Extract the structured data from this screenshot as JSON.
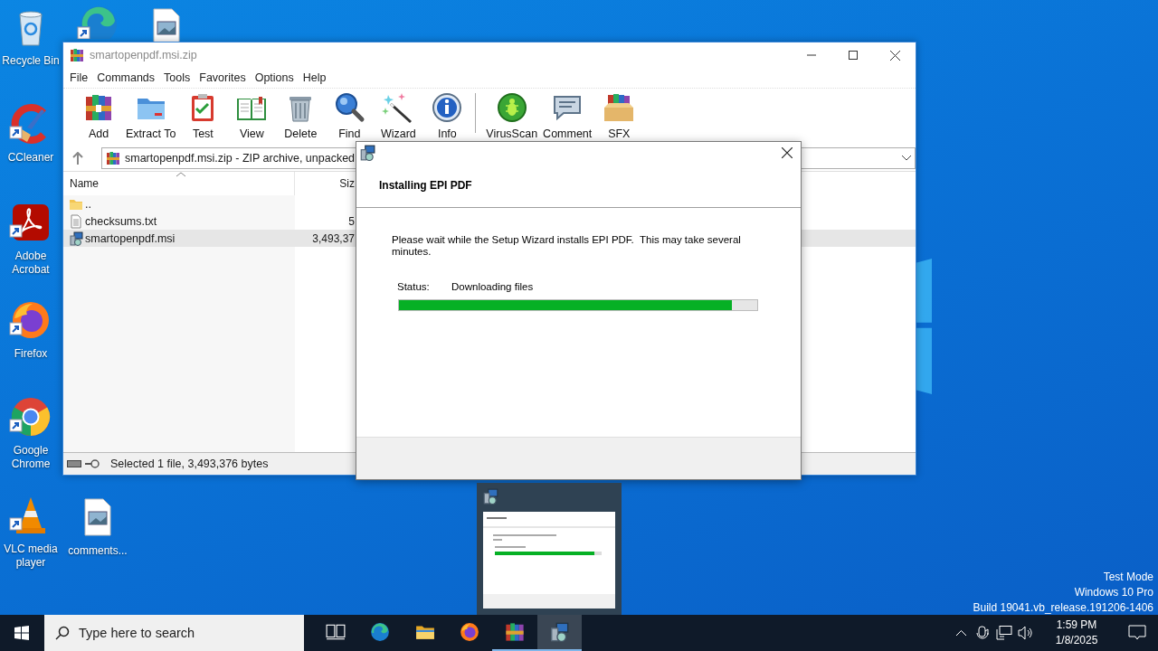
{
  "desktop_icons": [
    {
      "kind": "recycle-bin",
      "label": "Recycle Bin",
      "shortcut": false
    },
    {
      "kind": "edge",
      "shortcut": true
    },
    {
      "kind": "image-file",
      "shortcut": false
    },
    {
      "kind": "ccleaner",
      "label": "CCleaner",
      "shortcut": true
    },
    {
      "kind": "acrobat",
      "label": "Adobe Acrobat",
      "shortcut": true
    },
    {
      "kind": "firefox",
      "label": "Firefox",
      "shortcut": true
    },
    {
      "kind": "chrome",
      "label": "Google Chrome",
      "shortcut": true
    },
    {
      "kind": "vlc",
      "label": "VLC media player",
      "shortcut": true
    },
    {
      "kind": "image-file",
      "label": "comments...",
      "shortcut": false
    }
  ],
  "archiver": {
    "title": "smartopenpdf.msi.zip",
    "menu": [
      "File",
      "Commands",
      "Tools",
      "Favorites",
      "Options",
      "Help"
    ],
    "toolbar": [
      {
        "kind": "add",
        "label": "Add"
      },
      {
        "kind": "extract",
        "label": "Extract To"
      },
      {
        "kind": "test",
        "label": "Test"
      },
      {
        "kind": "view",
        "label": "View"
      },
      {
        "kind": "delete",
        "label": "Delete"
      },
      {
        "kind": "find",
        "label": "Find"
      },
      {
        "kind": "wizard",
        "label": "Wizard"
      },
      {
        "kind": "info",
        "label": "Info"
      },
      {
        "kind": "separator"
      },
      {
        "kind": "virusscan",
        "label": "VirusScan"
      },
      {
        "kind": "comment",
        "label": "Comment"
      },
      {
        "kind": "sfx",
        "label": "SFX"
      }
    ],
    "address": "smartopenpdf.msi.zip - ZIP archive, unpacked",
    "columns": [
      "Name",
      "Siz"
    ],
    "rows": [
      {
        "kind": "folder",
        "name": "..",
        "selected": false
      },
      {
        "kind": "text",
        "name": "checksums.txt",
        "size": "5",
        "selected": false
      },
      {
        "kind": "installer",
        "name": "smartopenpdf.msi",
        "size": "3,493,37",
        "selected": true
      }
    ],
    "status": "Selected 1 file, 3,493,376 bytes"
  },
  "dialog": {
    "heading": "Installing EPI PDF",
    "message": "Please wait while the Setup Wizard installs EPI PDF.  This may take several minutes.",
    "status_label": "Status:",
    "status": "Downloading files",
    "level": 0.93
  },
  "taskbar": {
    "search_placeholder": "Type here to search",
    "apps": [
      {
        "kind": "task-view",
        "running": false,
        "selected": false
      },
      {
        "kind": "edge",
        "running": false,
        "selected": false
      },
      {
        "kind": "explorer",
        "running": false,
        "selected": false
      },
      {
        "kind": "firefox",
        "running": false,
        "selected": false
      },
      {
        "kind": "archiver",
        "running": true,
        "selected": false
      },
      {
        "kind": "installer",
        "running": true,
        "selected": true
      }
    ],
    "time": "1:59 PM",
    "date": "1/8/2025"
  },
  "system_notice": [
    "Test Mode",
    "Windows 10 Pro",
    "Build 19041.vb_release.191206-1406"
  ]
}
